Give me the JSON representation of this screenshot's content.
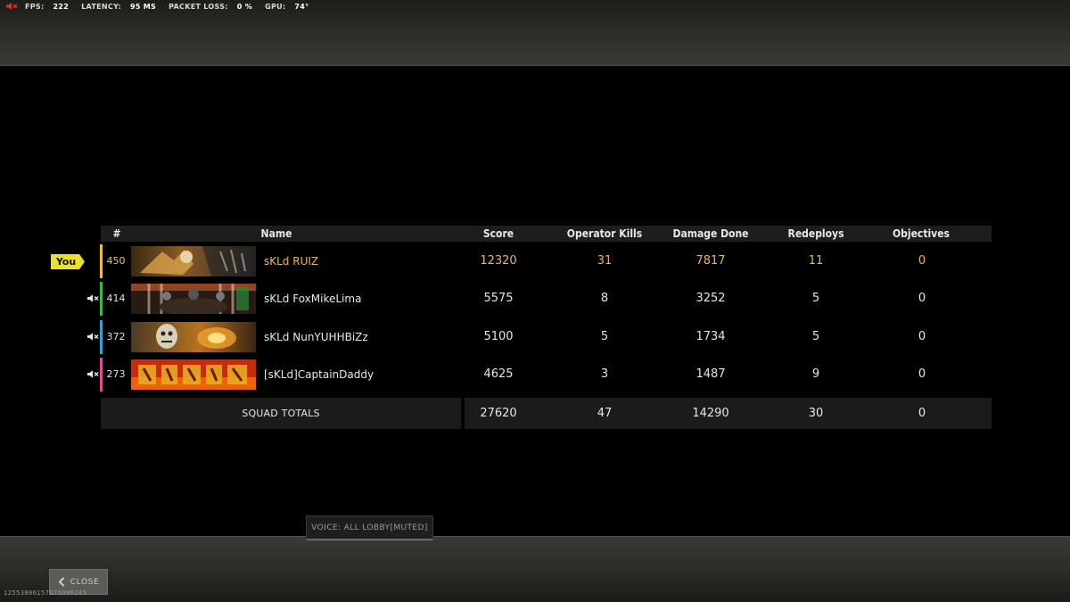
{
  "perf": {
    "fps_label": "FPS:",
    "fps": "222",
    "latency_label": "LATENCY:",
    "latency": "95 MS",
    "packet_loss_label": "PACKET LOSS:",
    "packet_loss": "0 %",
    "gpu_label": "GPU:",
    "gpu": "74°"
  },
  "table": {
    "headers": {
      "rank": "#",
      "name": "Name",
      "score": "Score",
      "operator_kills": "Operator Kills",
      "damage": "Damage Done",
      "redeploys": "Redeploys",
      "objectives": "Objectives"
    },
    "you_tag": "You",
    "players": [
      {
        "level": "450",
        "name": "sKLd RUIZ",
        "score": "12320",
        "kills": "31",
        "damage": "7817",
        "redeploys": "11",
        "objectives": "0",
        "accent": "#f0c02a",
        "is_you": true
      },
      {
        "level": "414",
        "name": "sKLd FoxMikeLima",
        "score": "5575",
        "kills": "8",
        "damage": "3252",
        "redeploys": "5",
        "objectives": "0",
        "accent": "#2fbf4a",
        "muted_icon": "speaker-muted-icon"
      },
      {
        "level": "372",
        "name": "sKLd NunYUHHBiZz",
        "score": "5100",
        "kills": "5",
        "damage": "1734",
        "redeploys": "5",
        "objectives": "0",
        "accent": "#2aa6d8",
        "muted_icon": "speaker-muted-icon"
      },
      {
        "level": "273",
        "name": "[sKLd]CaptainDaddy",
        "score": "4625",
        "kills": "3",
        "damage": "1487",
        "redeploys": "9",
        "objectives": "0",
        "accent": "#e0489a",
        "muted_icon": "speaker-muted-icon"
      }
    ],
    "totals": {
      "label": "SQUAD TOTALS",
      "score": "27620",
      "kills": "47",
      "damage": "14290",
      "redeploys": "30",
      "objectives": "0"
    }
  },
  "voice": {
    "label": "VOICE: ALL LOBBY[MUTED]"
  },
  "close_button": {
    "label": "CLOSE",
    "icon": "chevron-left-icon"
  },
  "session_id": "12553886157070096245",
  "colors": {
    "highlight": "#f0b74a",
    "you_tag": "#ece02a"
  }
}
